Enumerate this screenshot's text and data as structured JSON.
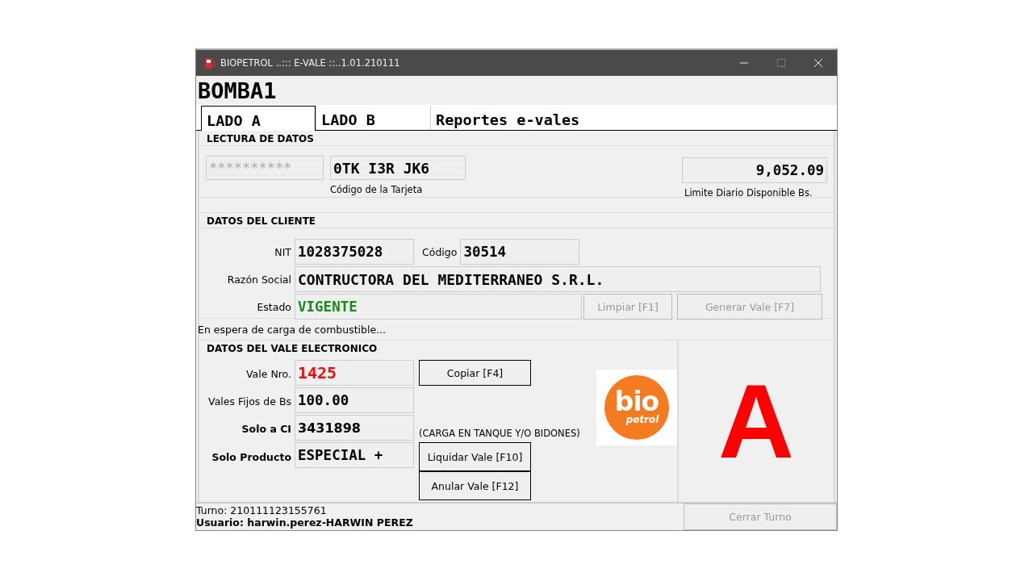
{
  "window": {
    "title": "BIOPETROL ..::: E-VALE ::..1.01.210111"
  },
  "pump_name": "BOMBA1",
  "tabs": [
    {
      "label": "LADO A",
      "selected": true
    },
    {
      "label": "LADO B",
      "selected": false
    },
    {
      "label": "Reportes e-vales",
      "selected": false
    }
  ],
  "card_reading": {
    "title": "LECTURA DE DATOS",
    "masked_code": "**********",
    "card_code": "0TK I3R JK6",
    "card_code_label": "Código de la Tarjeta",
    "daily_limit": "9,052.09",
    "daily_limit_label": "Limite Diario Disponible Bs."
  },
  "client": {
    "title": "DATOS DEL CLIENTE",
    "nit_label": "NIT",
    "nit": "1028375028",
    "code_label": "Código",
    "code": "30514",
    "name_label": "Razón Social",
    "name": "CONTRUCTORA DEL MEDITERRANEO S.R.L.",
    "status_label": "Estado",
    "status": "VIGENTE",
    "status_valid": true,
    "buttons": [
      {
        "label": "Limpiar [F1]",
        "disabled": true
      },
      {
        "label": "Generar Vale [F7]",
        "disabled": true
      }
    ]
  },
  "status_message": "En espera de carga de combustible...",
  "voucher": {
    "title": "DATOS DEL VALE ELECTRONICO",
    "fields": [
      {
        "label": "Vale Nro.",
        "value": "1425",
        "kind": "number"
      },
      {
        "label": "Vales Fijos de Bs",
        "value": "100.00",
        "kind": "amount"
      },
      {
        "label": "Solo a CI",
        "value": "3431898",
        "kind": "restriction"
      },
      {
        "label": "Solo Producto",
        "value": "ESPECIAL +",
        "kind": "product"
      }
    ],
    "copy_button": {
      "label": "Copiar [F4]",
      "disabled": false
    },
    "note": "(CARGA EN TANQUE Y/O BIDONES)",
    "settle_button": {
      "label": "Liquidar Vale [F10]",
      "disabled": false
    },
    "cancel_button": {
      "label": "Anular Vale [F12]",
      "disabled": false
    },
    "logo": {
      "line_1": "bio",
      "line_2": "petrol"
    },
    "side": "A"
  },
  "footer": {
    "shift": "Turno: 210111123155761",
    "user": "Usuario: harwin.perez-HARWIN PEREZ",
    "close_button": {
      "label": "Cerrar Turno",
      "disabled": true
    }
  }
}
